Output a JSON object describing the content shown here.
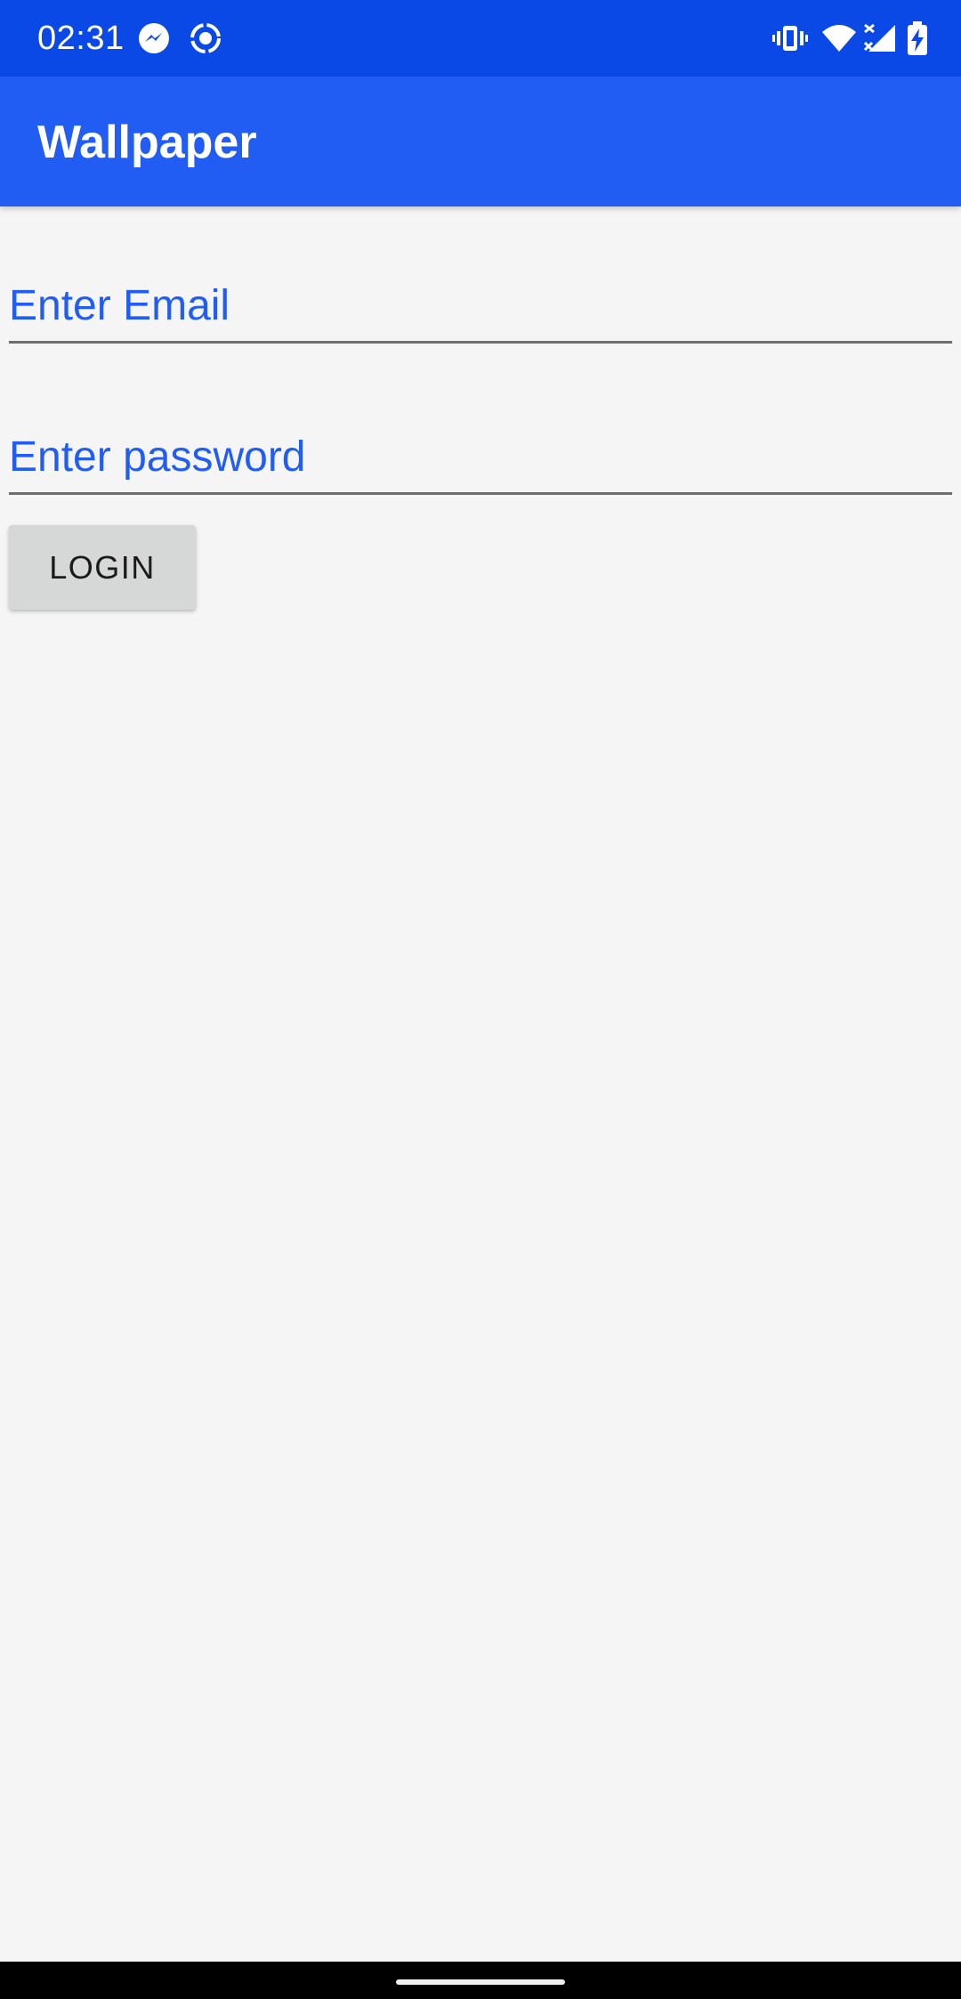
{
  "status_bar": {
    "time": "02:31",
    "left_icons": [
      "messenger-icon",
      "screen-record-icon"
    ],
    "right_icons": [
      "vibrate-icon",
      "wifi-icon",
      "no-signal-icon",
      "battery-charging-icon"
    ]
  },
  "app_bar": {
    "title": "Wallpaper"
  },
  "form": {
    "email_placeholder": "Enter Email",
    "email_value": "",
    "password_placeholder": "Enter password",
    "password_value": "",
    "login_label": "LOGIN"
  },
  "colors": {
    "status_bar": "#0a49e6",
    "app_bar": "#215df2",
    "accent": "#215df2",
    "background": "#f5f5f5",
    "button": "#d6d7d7"
  }
}
